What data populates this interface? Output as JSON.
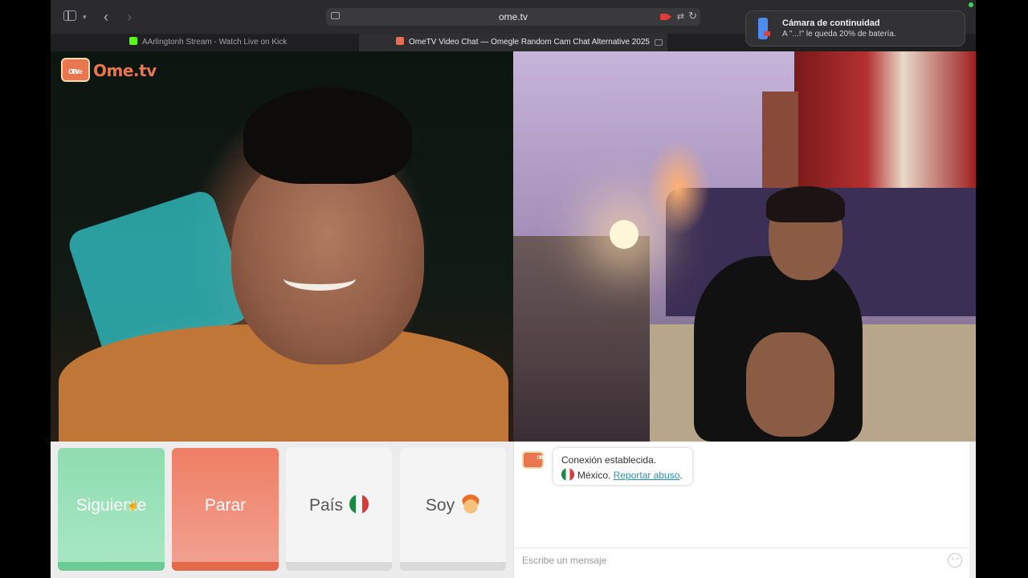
{
  "browser": {
    "url": "ome.tv",
    "tabs": [
      {
        "title": "AArlingtonh Stream - Watch Live on Kick"
      },
      {
        "title": "OmeTV Video Chat — Omegle Random Cam Chat Alternative 2025"
      }
    ],
    "icons": {
      "sidebar": "sidebar-icon",
      "back": "chevron-left-icon",
      "forward": "chevron-right-icon",
      "reload": "reload-icon"
    }
  },
  "notification": {
    "title": "Cámara de continuidad",
    "body": "A \"...!\" le queda 20% de batería."
  },
  "app": {
    "logo_text": "Ome.tv",
    "logo_badge_line1": "Ome",
    "logo_badge_line2": "TV"
  },
  "controls": {
    "next_label": "Siguiente",
    "stop_label": "Parar",
    "country_label": "País",
    "gender_label": "Soy"
  },
  "chat": {
    "connection_message": "Conexión establecida.",
    "country_name": "México.",
    "report_link": "Reportar abuso",
    "input_placeholder": "Escribe un mensaje"
  },
  "colors": {
    "next": "#8fdcb0",
    "stop": "#ef7e64",
    "brand": "#e8764e",
    "link": "#2a8fae"
  }
}
